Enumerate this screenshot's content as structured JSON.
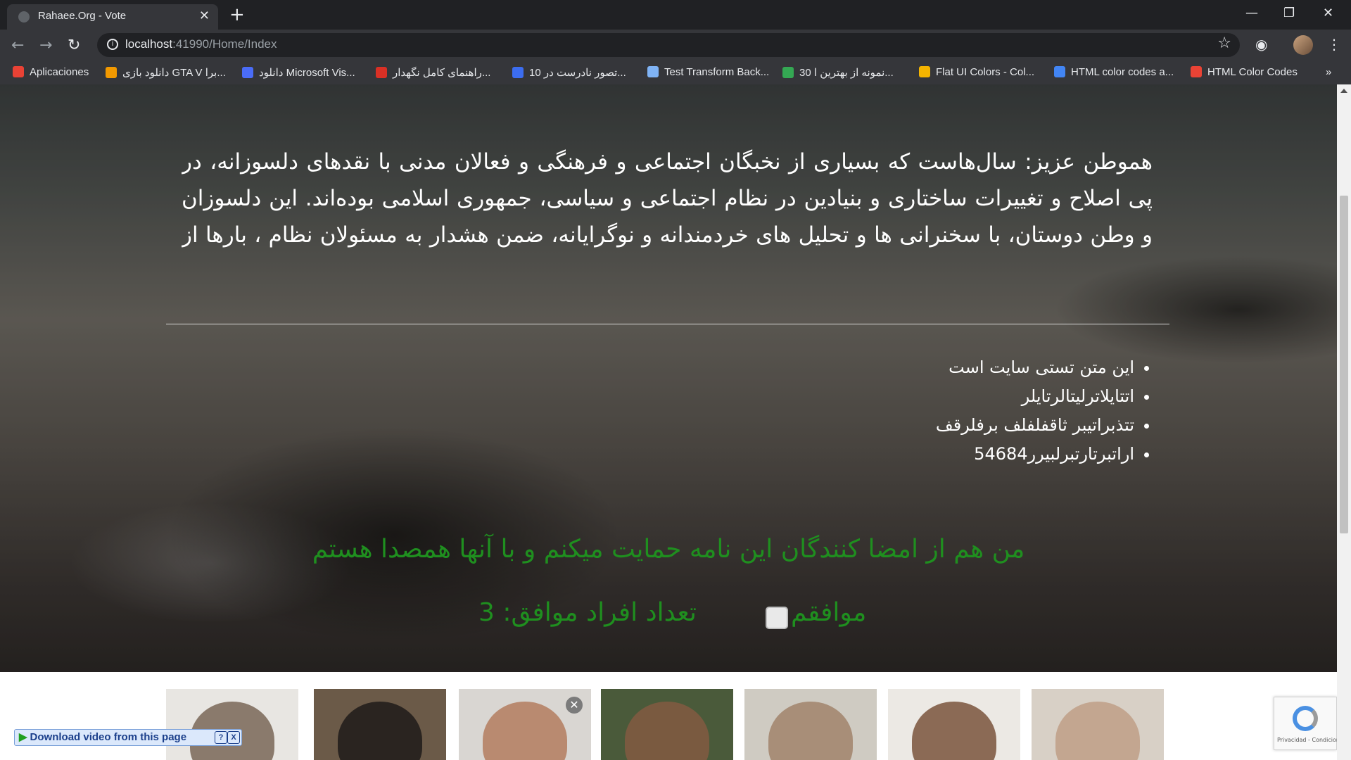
{
  "browser": {
    "tab_title": "Rahaee.Org - Vote",
    "tab_close": "✕",
    "new_tab": "+",
    "url_host": "localhost",
    "url_path": ":41990/Home/Index",
    "window_controls": {
      "minimize": "—",
      "restore": "❐",
      "close": "✕"
    }
  },
  "bookmarks": [
    {
      "label": "Aplicaciones",
      "icon": "apps-grid-icon",
      "color": "#e94235"
    },
    {
      "label": "دانلود بازی GTA V برا...",
      "icon": "diamond-icon",
      "color": "#f29900"
    },
    {
      "label": "دانلود Microsoft Vis...",
      "icon": "shield-icon",
      "color": "#4a6cf7"
    },
    {
      "label": "راهنمای کامل نگهدار...",
      "icon": "x-logo-icon",
      "color": "#d93025"
    },
    {
      "label": "10 تصور نادرست در...",
      "icon": "bolt-icon",
      "color": "#3c6df0"
    },
    {
      "label": "Test Transform Back...",
      "icon": "cross-icon",
      "color": "#7fb3f5"
    },
    {
      "label": "30 نمونه از بهترین ا...",
      "icon": "rainbow-icon",
      "color": "#34a853"
    },
    {
      "label": "Flat UI Colors - Col...",
      "icon": "palette-icon",
      "color": "#f4b400"
    },
    {
      "label": "HTML color codes a...",
      "icon": "c-logo-icon",
      "color": "#4285f4"
    },
    {
      "label": "HTML Color Codes",
      "icon": "c-logo-icon",
      "color": "#ea4335"
    }
  ],
  "bookmarks_more": "»",
  "page": {
    "paragraph": "هموطن عزیز: سال‌هاست که بسیاری از نخبگان اجتماعی و فرهنگی و فعالان مدنی با نقدهای دلسوزانه، در پی اصلاح و تغییرات ساختاری و بنیادین در نظام اجتماعی و سیاسی، جمهوری اسلامی بوده‌اند. این دلسوزان و وطن دوستان، با سخنرانی ها و تحلیل های خردمندانه و نوگرایانه، ضمن هشدار به مسئولان نظام ، بارها از آنان خواسته اند با احترام به رأی مردم و رعایت حقوق شهروندی، نسبت به تغییر روش هائی که فرسنگ ها با",
    "list_items": [
      "این متن تستی سایت است",
      "اتتایلاترلیتالرتایلر",
      "تتذبراتیبر ثاقفلفلف برفلرقف",
      "اراتبرتارتبرلبیرر54684"
    ],
    "support_text": "من هم از امضا کنندگان این نامه حمایت میکنم و با آنها همصدا هستم",
    "agree_label": "موافقم",
    "count_label": "تعداد افراد موافق: 3",
    "accent_green": "#1f8f1f"
  },
  "overlay": {
    "download_label": "Download video from this page",
    "help": "?",
    "close": "X",
    "photo_close": "✕",
    "captcha_caption": "Privacidad - Condiciones"
  }
}
